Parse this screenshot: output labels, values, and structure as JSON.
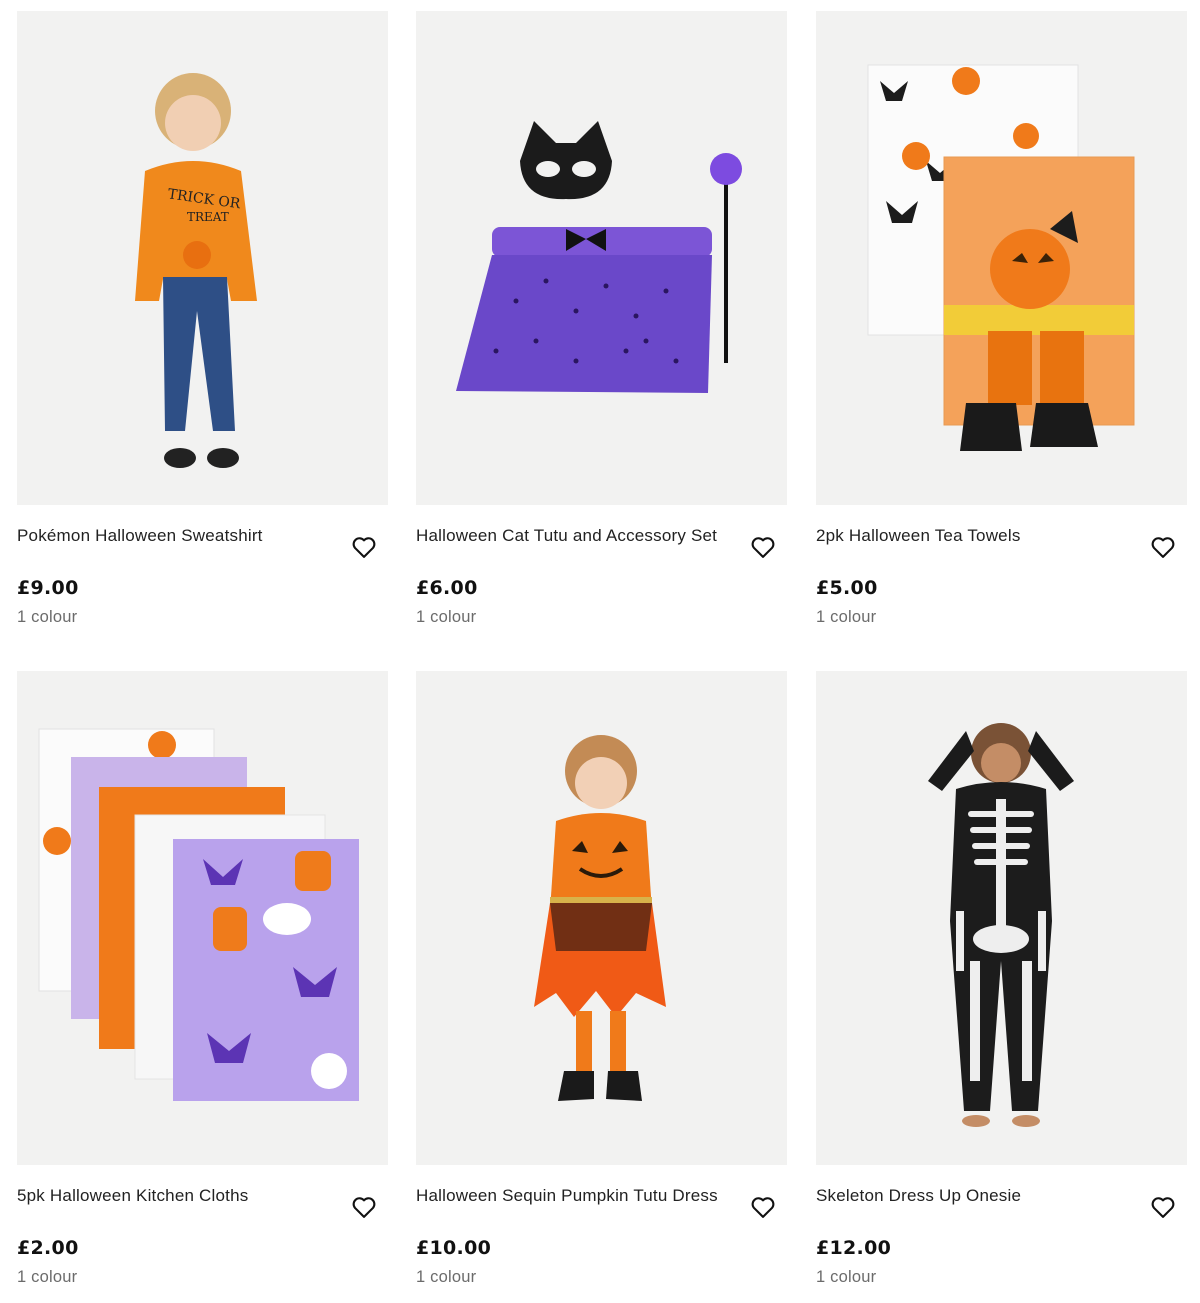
{
  "products": [
    {
      "name": "Pokémon Halloween Sweatshirt",
      "price": "£9.00",
      "colours": "1 colour",
      "image": "boy-orange-sweatshirt-jeans",
      "favourite_icon": "heart-outline-icon"
    },
    {
      "name": "Halloween Cat Tutu and Accessory Set",
      "price": "£6.00",
      "colours": "1 colour",
      "image": "cat-mask-purple-tutu-wand",
      "favourite_icon": "heart-outline-icon"
    },
    {
      "name": "2pk Halloween Tea Towels",
      "price": "£5.00",
      "colours": "1 colour",
      "image": "pumpkin-tea-towels",
      "favourite_icon": "heart-outline-icon"
    },
    {
      "name": "5pk Halloween Kitchen Cloths",
      "price": "£2.00",
      "colours": "1 colour",
      "image": "halloween-kitchen-cloths-stack",
      "favourite_icon": "heart-outline-icon"
    },
    {
      "name": "Halloween Sequin Pumpkin Tutu Dress",
      "price": "£10.00",
      "colours": "1 colour",
      "image": "girl-pumpkin-tutu-dress",
      "favourite_icon": "heart-outline-icon"
    },
    {
      "name": "Skeleton Dress Up Onesie",
      "price": "£12.00",
      "colours": "1 colour",
      "image": "child-skeleton-onesie",
      "favourite_icon": "heart-outline-icon"
    }
  ],
  "colors": {
    "image_bg": "#f2f2f1",
    "text": "#222222",
    "muted": "#6b6b6b",
    "orange": "#f07a1a",
    "purple": "#6a3fc2"
  }
}
